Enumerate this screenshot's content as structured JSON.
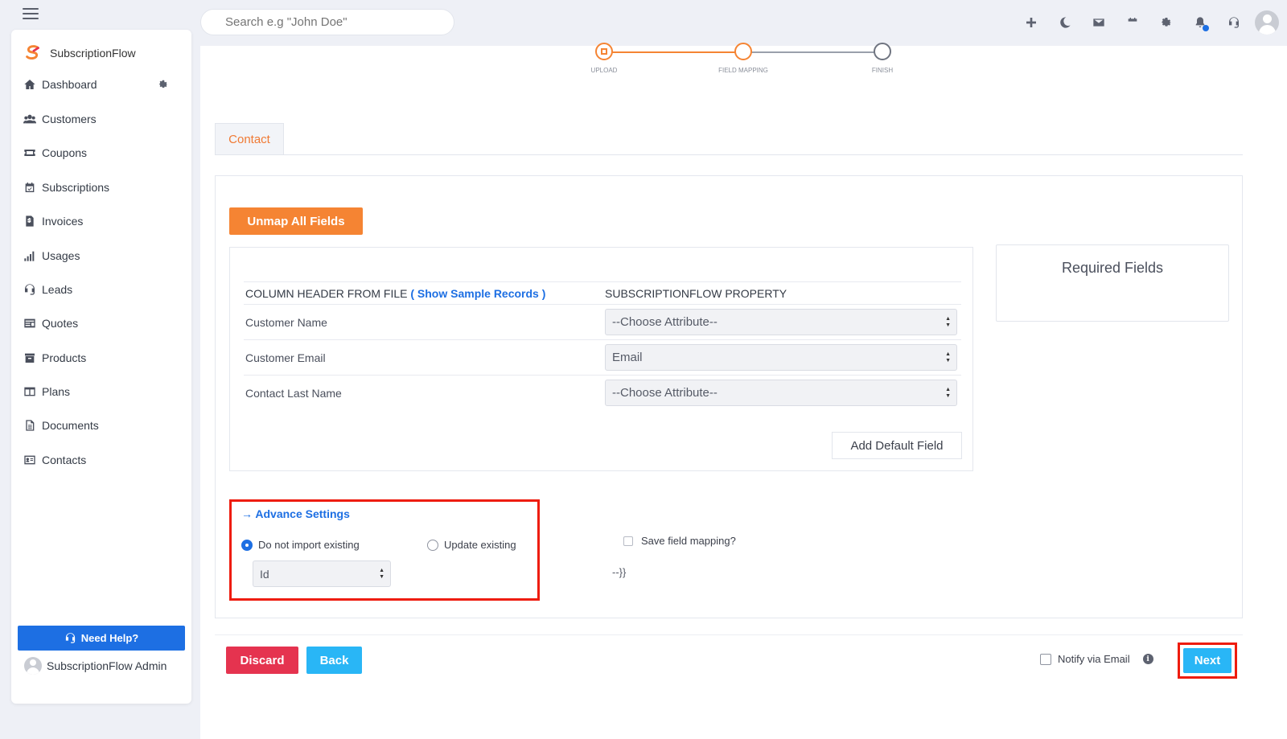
{
  "app": {
    "name": "SubscriptionFlow",
    "accent": "#f58433",
    "primary": "#1d6fe3"
  },
  "search": {
    "placeholder": "Search e.g \"John Doe\""
  },
  "topbar": {
    "icons": [
      "plus-icon",
      "moon-icon",
      "mail-icon",
      "calendar-icon",
      "gear-icon",
      "bell-icon",
      "headset-icon",
      "avatar"
    ]
  },
  "sidebar": {
    "items": [
      {
        "label": "Dashboard",
        "icon": "home-icon"
      },
      {
        "label": "Customers",
        "icon": "users-icon"
      },
      {
        "label": "Coupons",
        "icon": "ticket-icon"
      },
      {
        "label": "Subscriptions",
        "icon": "calendar-check-icon"
      },
      {
        "label": "Invoices",
        "icon": "invoice-icon"
      },
      {
        "label": "Usages",
        "icon": "signal-icon"
      },
      {
        "label": "Leads",
        "icon": "headset-icon"
      },
      {
        "label": "Quotes",
        "icon": "quote-icon"
      },
      {
        "label": "Products",
        "icon": "box-icon"
      },
      {
        "label": "Plans",
        "icon": "plans-icon"
      },
      {
        "label": "Documents",
        "icon": "document-icon"
      },
      {
        "label": "Contacts",
        "icon": "contact-card-icon"
      }
    ],
    "help_label": "Need Help?",
    "admin_name": "SubscriptionFlow Admin"
  },
  "stepper": {
    "steps": [
      {
        "label": "UPLOAD",
        "state": "done"
      },
      {
        "label": "FIELD MAPPING",
        "state": "active"
      },
      {
        "label": "FINISH",
        "state": "pending"
      }
    ]
  },
  "tab": {
    "label": "Contact"
  },
  "mapping": {
    "unmap_label": "Unmap All Fields",
    "header_file": "COLUMN HEADER FROM FILE",
    "sample_link": "( Show Sample Records )",
    "header_property": "SUBSCRIPTIONFLOW PROPERTY",
    "rows": [
      {
        "column": "Customer Name",
        "value": "--Choose Attribute--"
      },
      {
        "column": "Customer Email",
        "value": "Email"
      },
      {
        "column": "Contact Last Name",
        "value": "--Choose Attribute--"
      }
    ],
    "add_default_label": "Add Default Field",
    "required_title": "Required Fields"
  },
  "advance": {
    "title": "Advance Settings",
    "option_skip": "Do not import existing",
    "option_update": "Update existing",
    "selected": "skip",
    "key_select": "Id",
    "save_mapping_label": "Save field mapping?",
    "brace_text": "--}}"
  },
  "footer": {
    "discard_label": "Discard",
    "back_label": "Back",
    "notify_label": "Notify via Email",
    "next_label": "Next"
  }
}
